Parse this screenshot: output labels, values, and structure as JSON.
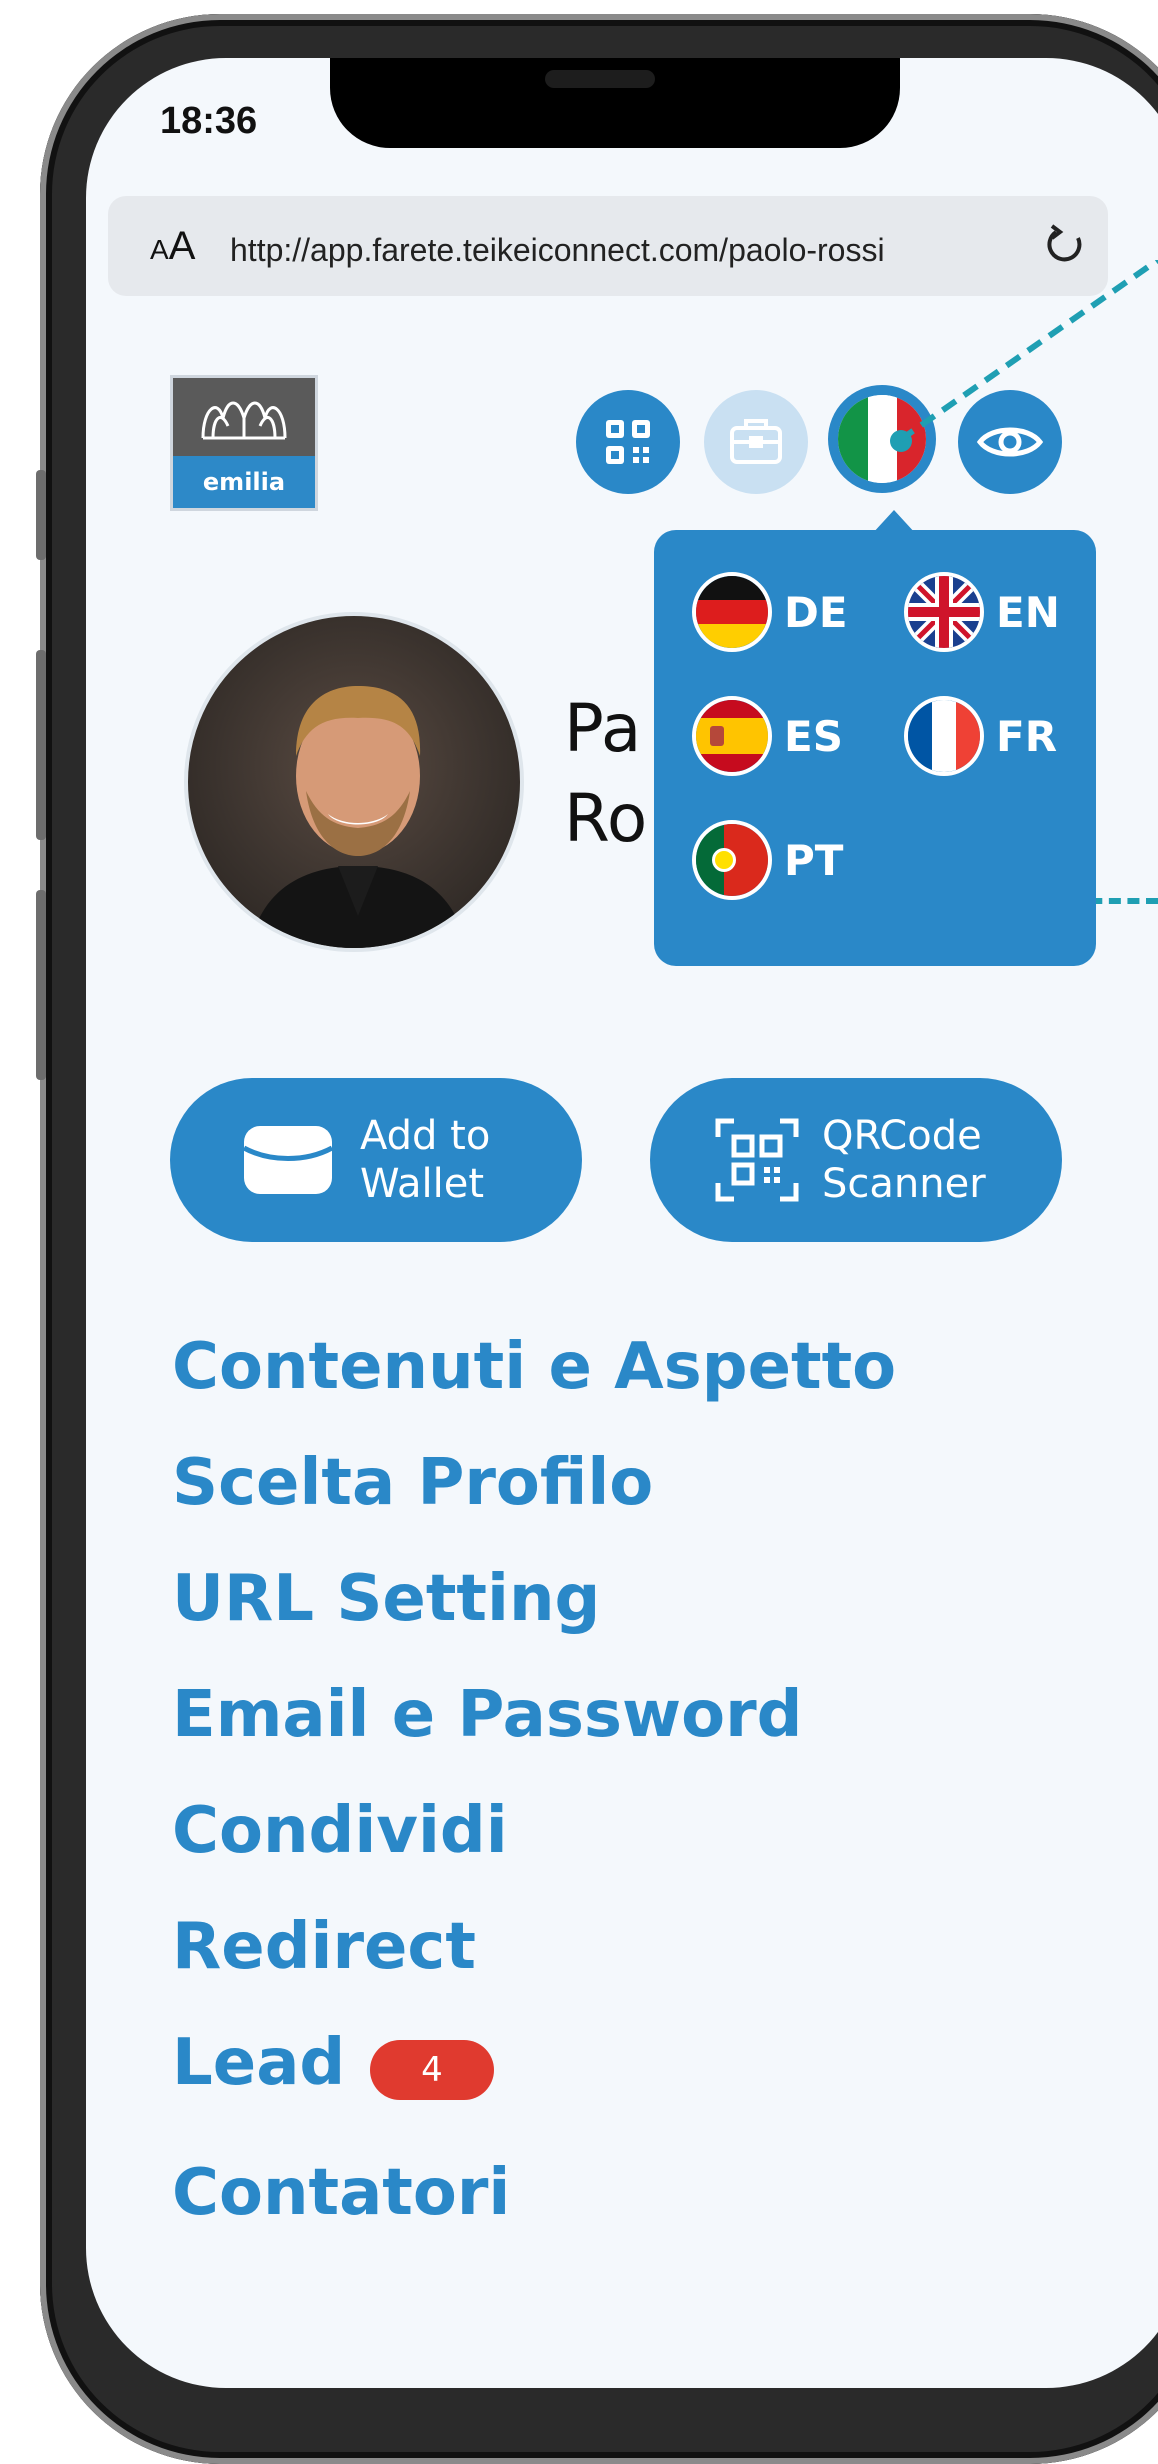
{
  "status_bar": {
    "time": "18:36"
  },
  "browser": {
    "text_size_small": "A",
    "text_size_large": "A",
    "url": "http://app.farete.teikeiconnect.com/paolo-rossi"
  },
  "logo": {
    "text": "emilia"
  },
  "header_buttons": [
    "qr-code-icon",
    "briefcase-icon",
    "italian-flag-icon",
    "eye-icon"
  ],
  "language_menu": {
    "items": [
      {
        "code": "DE",
        "flag": "germany"
      },
      {
        "code": "EN",
        "flag": "united-kingdom"
      },
      {
        "code": "ES",
        "flag": "spain"
      },
      {
        "code": "FR",
        "flag": "france"
      },
      {
        "code": "PT",
        "flag": "portugal"
      }
    ]
  },
  "profile": {
    "name_line1": "Paolo",
    "name_line2": "Rossi",
    "visible_line1": "Pa",
    "visible_line2": "Ro"
  },
  "actions": {
    "wallet_line1": "Add to",
    "wallet_line2": "Wallet",
    "scanner_line1": "QRCode",
    "scanner_line2": "Scanner"
  },
  "menu": [
    {
      "label": "Contenuti e Aspetto"
    },
    {
      "label": "Scelta Profilo"
    },
    {
      "label": "URL Setting"
    },
    {
      "label": "Email e Password"
    },
    {
      "label": "Condividi"
    },
    {
      "label": "Redirect"
    },
    {
      "label": "Lead",
      "badge": "4"
    },
    {
      "label": "Contatori"
    }
  ],
  "colors": {
    "accent": "#2a88c8",
    "badge": "#e03a2f",
    "callout": "#1f9fb3",
    "background": "#f4f8fc"
  }
}
